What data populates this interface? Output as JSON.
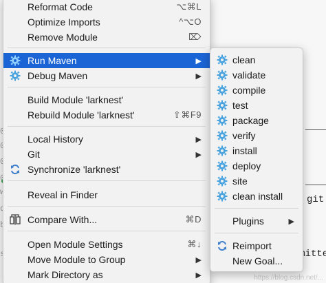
{
  "main_menu": {
    "items": [
      {
        "label": "Reformat Code",
        "shortcut": "⌥⌘L"
      },
      {
        "label": "Optimize Imports",
        "shortcut": "^⌥O"
      },
      {
        "label": "Remove Module",
        "shortcut": "⌦"
      },
      {
        "label": "Run Maven"
      },
      {
        "label": "Debug Maven"
      },
      {
        "label": "Build Module 'larknest'"
      },
      {
        "label": "Rebuild Module 'larknest'",
        "shortcut": "⇧⌘F9"
      },
      {
        "label": "Local History"
      },
      {
        "label": "Git"
      },
      {
        "label": "Synchronize 'larknest'"
      },
      {
        "label": "Reveal in Finder"
      },
      {
        "label": "Compare With...",
        "shortcut": "⌘D"
      },
      {
        "label": "Open Module Settings",
        "shortcut": "⌘↓"
      },
      {
        "label": "Move Module to Group"
      },
      {
        "label": "Mark Directory as"
      }
    ]
  },
  "maven_submenu": {
    "goals": [
      "clean",
      "validate",
      "compile",
      "test",
      "package",
      "verify",
      "install",
      "deploy",
      "site",
      "clean install"
    ],
    "plugins_label": "Plugins",
    "reimport_label": "Reimport",
    "new_goal_label": "New Goal..."
  },
  "background": {
    "git_fragment": "git",
    "committed_fragment": "committed",
    "watermark": "https://blog.csdn.net/..."
  },
  "colors": {
    "selection": "#1b64d6",
    "maven_icon": "#4aa3df",
    "sync_icon": "#3d7fcc"
  }
}
